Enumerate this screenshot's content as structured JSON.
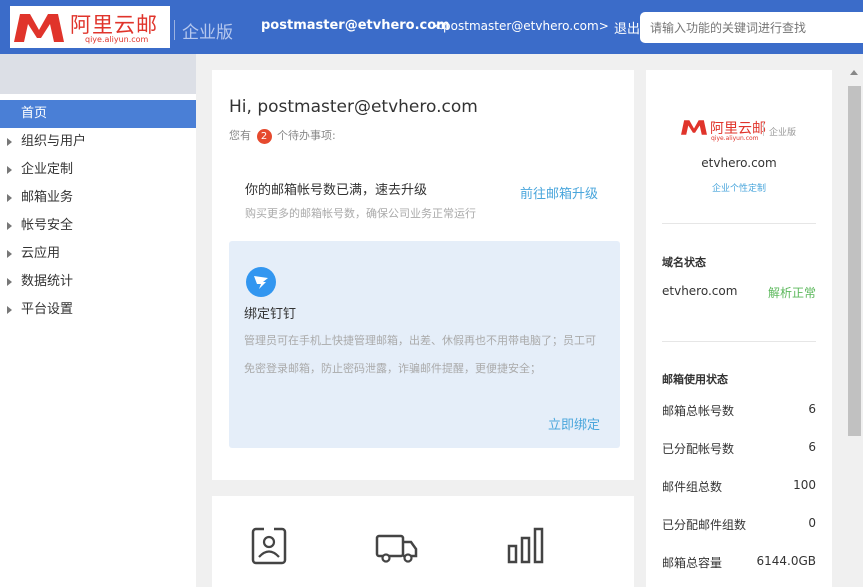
{
  "header": {
    "brand": "阿里云邮",
    "brand_url": "qiye.aliyun.com",
    "edition": "企业版",
    "user": "postmaster@etvhero.com",
    "user_full": "<postmaster@etvhero.com>",
    "logout": "退出",
    "search_placeholder": "请输入功能的关键词进行查找"
  },
  "sidebar": {
    "items": [
      {
        "label": "首页",
        "active": true
      },
      {
        "label": "组织与用户"
      },
      {
        "label": "企业定制"
      },
      {
        "label": "邮箱业务"
      },
      {
        "label": "帐号安全"
      },
      {
        "label": "云应用"
      },
      {
        "label": "数据统计"
      },
      {
        "label": "平台设置"
      }
    ]
  },
  "main": {
    "greeting": "Hi, postmaster@etvhero.com",
    "todo_prefix": "您有",
    "todo_count": "2",
    "todo_suffix": "个待办事项:",
    "task": {
      "title": "你的邮箱帐号数已满，速去升级",
      "subtitle": "购买更多的邮箱帐号数，确保公司业务正常运行",
      "link": "前往邮箱升级"
    },
    "dingtalk": {
      "title": "绑定钉钉",
      "description": "管理员可在手机上快捷管理邮箱，出差、休假再也不用带电脑了；员工可免密登录邮箱，防止密码泄露，诈骗邮件提醒，更便捷安全；",
      "link": "立即绑定"
    }
  },
  "right": {
    "brand": "阿里云邮",
    "brand_url": "qiye.aliyun.com",
    "edition": "企业版",
    "domain": "etvhero.com",
    "custom_link": "企业个性定制",
    "domain_status_title": "域名状态",
    "domain_name": "etvhero.com",
    "domain_status": "解析正常",
    "mail_status_title": "邮箱使用状态",
    "stats": [
      {
        "label": "邮箱总帐号数",
        "value": "6"
      },
      {
        "label": "已分配帐号数",
        "value": "6"
      },
      {
        "label": "邮件组总数",
        "value": "100"
      },
      {
        "label": "已分配邮件组数",
        "value": "0"
      },
      {
        "label": "邮箱总容量",
        "value": "6144.0GB"
      }
    ]
  },
  "colors": {
    "header_bg": "#3b6cc9",
    "brand_red": "#e0342b",
    "link_blue": "#4aa6dc",
    "active_nav": "#4a7fd6",
    "badge_red": "#e64a2e",
    "ok_green": "#5cb85c"
  },
  "icons": [
    "aliyun-mail-logo-icon",
    "dingtalk-icon",
    "contact-card-icon",
    "delivery-truck-icon",
    "bar-chart-icon",
    "expand-arrow-icon"
  ]
}
